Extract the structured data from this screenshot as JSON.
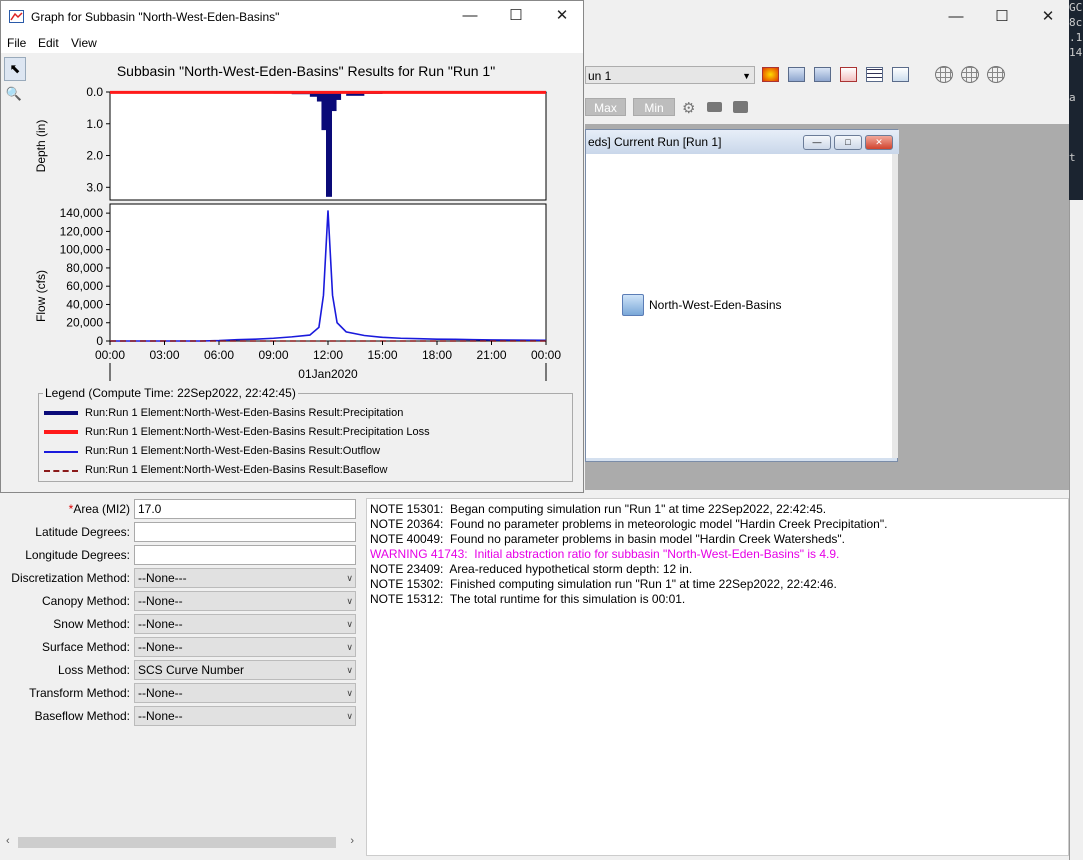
{
  "bg_edge_lines": [
    "GC",
    "8c",
    ".1",
    "14",
    "",
    "",
    "a",
    "",
    "",
    "",
    "t"
  ],
  "main_window": {
    "run_selector": {
      "value": "un 1"
    },
    "buttons": {
      "max": "Max",
      "min": "Min"
    }
  },
  "basin_window": {
    "title": "eds] Current Run [Run 1]",
    "element_label": "North-West-Eden-Basins"
  },
  "graph_window": {
    "title": "Graph for Subbasin \"North-West-Eden-Basins\"",
    "menus": [
      "File",
      "Edit",
      "View"
    ],
    "legend_title": "Legend (Compute Time: 22Sep2022, 22:42:45)",
    "legend": [
      {
        "label": "Run:Run 1 Element:North-West-Eden-Basins Result:Precipitation",
        "color": "#0a0a78",
        "style": "thick"
      },
      {
        "label": "Run:Run 1 Element:North-West-Eden-Basins Result:Precipitation Loss",
        "color": "#ff1a1a",
        "style": "thick"
      },
      {
        "label": "Run:Run 1 Element:North-West-Eden-Basins Result:Outflow",
        "color": "#1a1adc",
        "style": "thin"
      },
      {
        "label": "Run:Run 1 Element:North-West-Eden-Basins Result:Baseflow",
        "color": "#8b1a1a",
        "style": "dashed"
      }
    ]
  },
  "chart_data": {
    "type": "line",
    "title": "Subbasin \"North-West-Eden-Basins\" Results for Run \"Run 1\"",
    "date_label": "01Jan2020",
    "x_tick_labels": [
      "00:00",
      "03:00",
      "06:00",
      "09:00",
      "12:00",
      "15:00",
      "18:00",
      "21:00",
      "00:00"
    ],
    "x": [
      0,
      1,
      2,
      3,
      4,
      5,
      6,
      7,
      8,
      9,
      10,
      11,
      11.5,
      11.75,
      12,
      12.25,
      12.5,
      13,
      14,
      15,
      16,
      17,
      18,
      19,
      20,
      21,
      22,
      23,
      24
    ],
    "depth_panel": {
      "ylabel": "Depth (in)",
      "y_ticks": [
        "0.0",
        "1.0",
        "2.0",
        "3.0"
      ],
      "ylim": [
        0,
        3.4
      ],
      "inverted": true,
      "precipitation": [
        0.01,
        0.01,
        0.01,
        0.01,
        0.01,
        0.01,
        0.02,
        0.03,
        0.04,
        0.05,
        0.07,
        0.15,
        0.3,
        1.2,
        3.3,
        0.6,
        0.25,
        0.12,
        0.06,
        0.04,
        0.03,
        0.02,
        0.02,
        0.01,
        0.01,
        0.01,
        0.01,
        0.01,
        0.01
      ],
      "precipitation_loss": [
        0.01,
        0.01,
        0.01,
        0.01,
        0.01,
        0.01,
        0.01,
        0.01,
        0.01,
        0.01,
        0.01,
        0.01,
        0.01,
        0.01,
        0.01,
        0.01,
        0.01,
        0.01,
        0.01,
        0.01,
        0.01,
        0.01,
        0.01,
        0.01,
        0.01,
        0.01,
        0.01,
        0.01,
        0.01
      ]
    },
    "flow_panel": {
      "ylabel": "Flow (cfs)",
      "y_ticks": [
        "0",
        "20,000",
        "40,000",
        "60,000",
        "80,000",
        "100,000",
        "120,000",
        "140,000"
      ],
      "ylim": [
        0,
        150000
      ],
      "outflow": [
        0,
        0,
        0,
        0,
        0,
        0,
        500,
        1500,
        2000,
        3000,
        4500,
        6500,
        15000,
        50000,
        143000,
        50000,
        20000,
        10000,
        6000,
        4000,
        3000,
        2500,
        2000,
        1800,
        1500,
        1200,
        1000,
        900,
        800
      ],
      "baseflow": [
        0,
        0,
        0,
        0,
        0,
        0,
        0,
        0,
        0,
        0,
        0,
        0,
        0,
        0,
        0,
        0,
        0,
        0,
        0,
        0,
        0,
        0,
        0,
        0,
        0,
        0,
        0,
        0,
        0
      ]
    }
  },
  "properties": [
    {
      "label": "Area (MI2)",
      "required": true,
      "kind": "input",
      "value": "17.0"
    },
    {
      "label": "Latitude Degrees:",
      "required": false,
      "kind": "input",
      "value": ""
    },
    {
      "label": "Longitude Degrees:",
      "required": false,
      "kind": "input",
      "value": ""
    },
    {
      "label": "Discretization Method:",
      "required": false,
      "kind": "select",
      "value": "--None---"
    },
    {
      "label": "Canopy Method:",
      "required": false,
      "kind": "select",
      "value": "--None--"
    },
    {
      "label": "Snow Method:",
      "required": false,
      "kind": "select",
      "value": "--None--"
    },
    {
      "label": "Surface Method:",
      "required": false,
      "kind": "select",
      "value": "--None--"
    },
    {
      "label": "Loss Method:",
      "required": false,
      "kind": "select",
      "value": "SCS Curve Number"
    },
    {
      "label": "Transform Method:",
      "required": false,
      "kind": "select",
      "value": "--None--"
    },
    {
      "label": "Baseflow Method:",
      "required": false,
      "kind": "select",
      "value": "--None--"
    }
  ],
  "messages": [
    {
      "text": "NOTE 15301:  Began computing simulation run \"Run 1\" at time 22Sep2022, 22:42:45.",
      "level": "note"
    },
    {
      "text": "NOTE 20364:  Found no parameter problems in meteorologic model \"Hardin Creek Precipitation\".",
      "level": "note"
    },
    {
      "text": "NOTE 40049:  Found no parameter problems in basin model \"Hardin Creek Watersheds\".",
      "level": "note"
    },
    {
      "text": "WARNING 41743:  Initial abstraction ratio for subbasin \"North-West-Eden-Basins\" is 4.9.",
      "level": "warning"
    },
    {
      "text": "NOTE 23409:  Area-reduced hypothetical storm depth: 12 in.",
      "level": "note"
    },
    {
      "text": "NOTE 15302:  Finished computing simulation run \"Run 1\" at time 22Sep2022, 22:42:46.",
      "level": "note"
    },
    {
      "text": "NOTE 15312:  The total runtime for this simulation is 00:01.",
      "level": "note"
    }
  ]
}
